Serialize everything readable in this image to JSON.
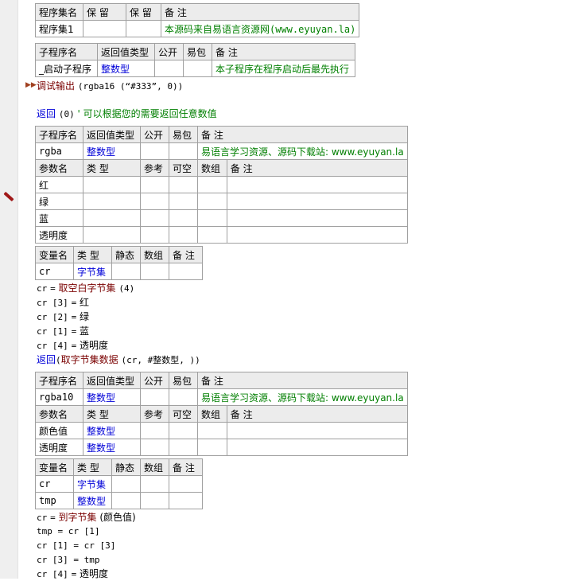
{
  "program_table": {
    "headers": [
      "程序集名",
      "保 留",
      "保 留",
      "备 注"
    ],
    "row": [
      "程序集1",
      "",
      "",
      "本源码来自易语言资源网(www.eyuyan.la)"
    ]
  },
  "startup_sub": {
    "headers": [
      "子程序名",
      "返回值类型",
      "公开",
      "易包",
      "备 注"
    ],
    "row": [
      "_启动子程序",
      "整数型",
      "",
      "",
      "本子程序在程序启动后最先执行"
    ]
  },
  "code_debug": {
    "fn": "调试输出",
    "args": "(rgba16 (“#333”, 0))"
  },
  "code_return0": {
    "kw": "返回",
    "args": "(0)",
    "comment": "' 可以根据您的需要返回任意数值"
  },
  "rgba_sub": {
    "headers": [
      "子程序名",
      "返回值类型",
      "公开",
      "易包",
      "备 注"
    ],
    "row": [
      "rgba",
      "整数型",
      "",
      "",
      "易语言学习资源、源码下载站: www.eyuyan.la"
    ],
    "param_headers": [
      "参数名",
      "类 型",
      "参考",
      "可空",
      "数组",
      "备 注"
    ],
    "params": [
      [
        "红",
        "",
        "",
        "",
        "",
        ""
      ],
      [
        "绿",
        "",
        "",
        "",
        "",
        ""
      ],
      [
        "蓝",
        "",
        "",
        "",
        "",
        ""
      ],
      [
        "透明度",
        "",
        "",
        "",
        "",
        ""
      ]
    ]
  },
  "rgba_vars": {
    "headers": [
      "变量名",
      "类 型",
      "静态",
      "数组",
      "备 注"
    ],
    "rows": [
      [
        "cr",
        "字节集",
        "",
        "",
        ""
      ]
    ]
  },
  "rgba_code": {
    "l1_var": "cr",
    "l1_eq": "=",
    "l1_fn": "取空白字节集",
    "l1_args": "(4)",
    "l2_idx": "cr [3]",
    "l2_eq": "=",
    "l2_val": "红",
    "l3_idx": "cr [2]",
    "l3_eq": "=",
    "l3_val": "绿",
    "l4_idx": "cr [1]",
    "l4_eq": "=",
    "l4_val": "蓝",
    "l5_idx": "cr [4]",
    "l5_eq": "=",
    "l5_val": "透明度",
    "l6_kw": "返回",
    "l6_open": "(",
    "l6_fn": "取字节集数据",
    "l6_args": "(cr, #整数型, ))"
  },
  "rgba10_sub": {
    "headers": [
      "子程序名",
      "返回值类型",
      "公开",
      "易包",
      "备 注"
    ],
    "row": [
      "rgba10",
      "整数型",
      "",
      "",
      "易语言学习资源、源码下载站: www.eyuyan.la"
    ],
    "param_headers": [
      "参数名",
      "类 型",
      "参考",
      "可空",
      "数组",
      "备 注"
    ],
    "params": [
      [
        "颜色值",
        "整数型",
        "",
        "",
        "",
        ""
      ],
      [
        "透明度",
        "整数型",
        "",
        "",
        "",
        ""
      ]
    ]
  },
  "rgba10_vars": {
    "headers": [
      "变量名",
      "类 型",
      "静态",
      "数组",
      "备 注"
    ],
    "rows": [
      [
        "cr",
        "字节集",
        "",
        "",
        ""
      ],
      [
        "tmp",
        "整数型",
        "",
        "",
        ""
      ]
    ]
  },
  "rgba10_code": {
    "l1_var": "cr",
    "l1_eq": "=",
    "l1_fn": "到字节集",
    "l1_args": "(颜色值)",
    "l2": "tmp = cr [1]",
    "l3": "cr [1] = cr [3]",
    "l4": "cr [3] = tmp",
    "l5_idx": "cr [4]",
    "l5_eq": "=",
    "l5_val": "透明度"
  }
}
